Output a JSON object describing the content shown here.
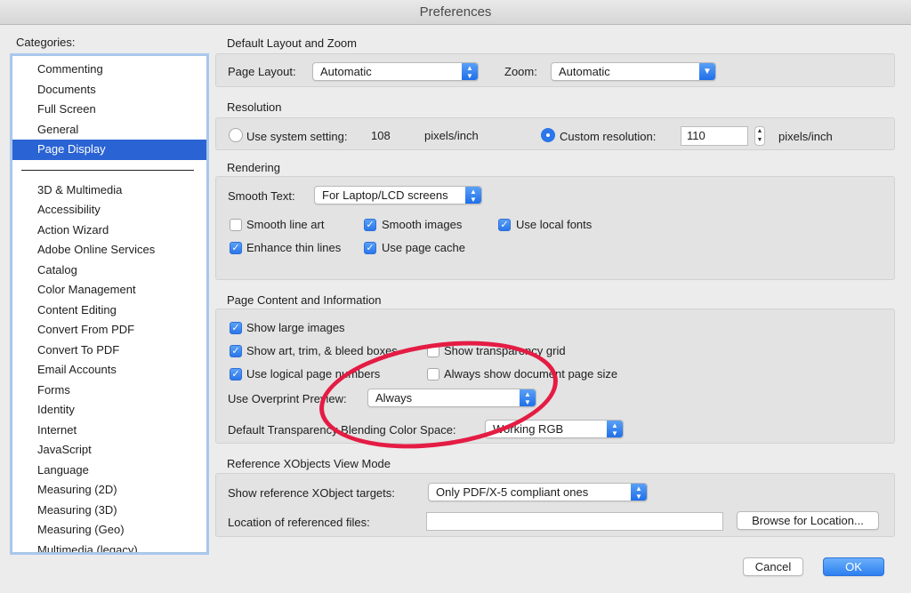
{
  "window": {
    "title": "Preferences"
  },
  "sidebar": {
    "label": "Categories:",
    "top_items": [
      {
        "label": "Commenting"
      },
      {
        "label": "Documents"
      },
      {
        "label": "Full Screen"
      },
      {
        "label": "General"
      },
      {
        "label": "Page Display",
        "selected": true
      }
    ],
    "items": [
      {
        "label": "3D & Multimedia"
      },
      {
        "label": "Accessibility"
      },
      {
        "label": "Action Wizard"
      },
      {
        "label": "Adobe Online Services"
      },
      {
        "label": "Catalog"
      },
      {
        "label": "Color Management"
      },
      {
        "label": "Content Editing"
      },
      {
        "label": "Convert From PDF"
      },
      {
        "label": "Convert To PDF"
      },
      {
        "label": "Email Accounts"
      },
      {
        "label": "Forms"
      },
      {
        "label": "Identity"
      },
      {
        "label": "Internet"
      },
      {
        "label": "JavaScript"
      },
      {
        "label": "Language"
      },
      {
        "label": "Measuring (2D)"
      },
      {
        "label": "Measuring (3D)"
      },
      {
        "label": "Measuring (Geo)"
      },
      {
        "label": "Multimedia (legacy)"
      }
    ]
  },
  "layout_zoom": {
    "title": "Default Layout and Zoom",
    "page_layout_label": "Page Layout:",
    "page_layout_value": "Automatic",
    "zoom_label": "Zoom:",
    "zoom_value": "Automatic"
  },
  "resolution": {
    "title": "Resolution",
    "system_label": "Use system setting:",
    "system_value": "108",
    "system_unit": "pixels/inch",
    "custom_label": "Custom resolution:",
    "custom_value": "110",
    "custom_unit": "pixels/inch",
    "selected": "custom"
  },
  "rendering": {
    "title": "Rendering",
    "smooth_text_label": "Smooth Text:",
    "smooth_text_value": "For Laptop/LCD screens",
    "smooth_line_art": {
      "label": "Smooth line art",
      "checked": false
    },
    "smooth_images": {
      "label": "Smooth images",
      "checked": true
    },
    "use_local_fonts": {
      "label": "Use local fonts",
      "checked": true
    },
    "enhance_thin_lines": {
      "label": "Enhance thin lines",
      "checked": true
    },
    "use_page_cache": {
      "label": "Use page cache",
      "checked": true
    }
  },
  "page_content": {
    "title": "Page Content and Information",
    "show_large_images": {
      "label": "Show large images",
      "checked": true
    },
    "show_art_trim_bleed": {
      "label": "Show art, trim, & bleed boxes",
      "checked": true
    },
    "show_transparency_grid": {
      "label": "Show transparency grid",
      "checked": false
    },
    "use_logical_page_numbers": {
      "label": "Use logical page numbers",
      "checked": true
    },
    "always_show_doc_page_size": {
      "label": "Always show document page size",
      "checked": false
    },
    "overprint_label": "Use Overprint Preview:",
    "overprint_value": "Always",
    "blending_label": "Default Transparency Blending Color Space:",
    "blending_value": "Working RGB"
  },
  "xobjects": {
    "title": "Reference XObjects View Mode",
    "targets_label": "Show reference XObject targets:",
    "targets_value": "Only PDF/X-5 compliant ones",
    "location_label": "Location of referenced files:",
    "location_value": "",
    "browse_label": "Browse for Location..."
  },
  "footer": {
    "cancel_label": "Cancel",
    "ok_label": "OK"
  },
  "colors": {
    "accent": "#2b76ea",
    "selection": "#2a63d4",
    "annotation": "#e41c44"
  }
}
